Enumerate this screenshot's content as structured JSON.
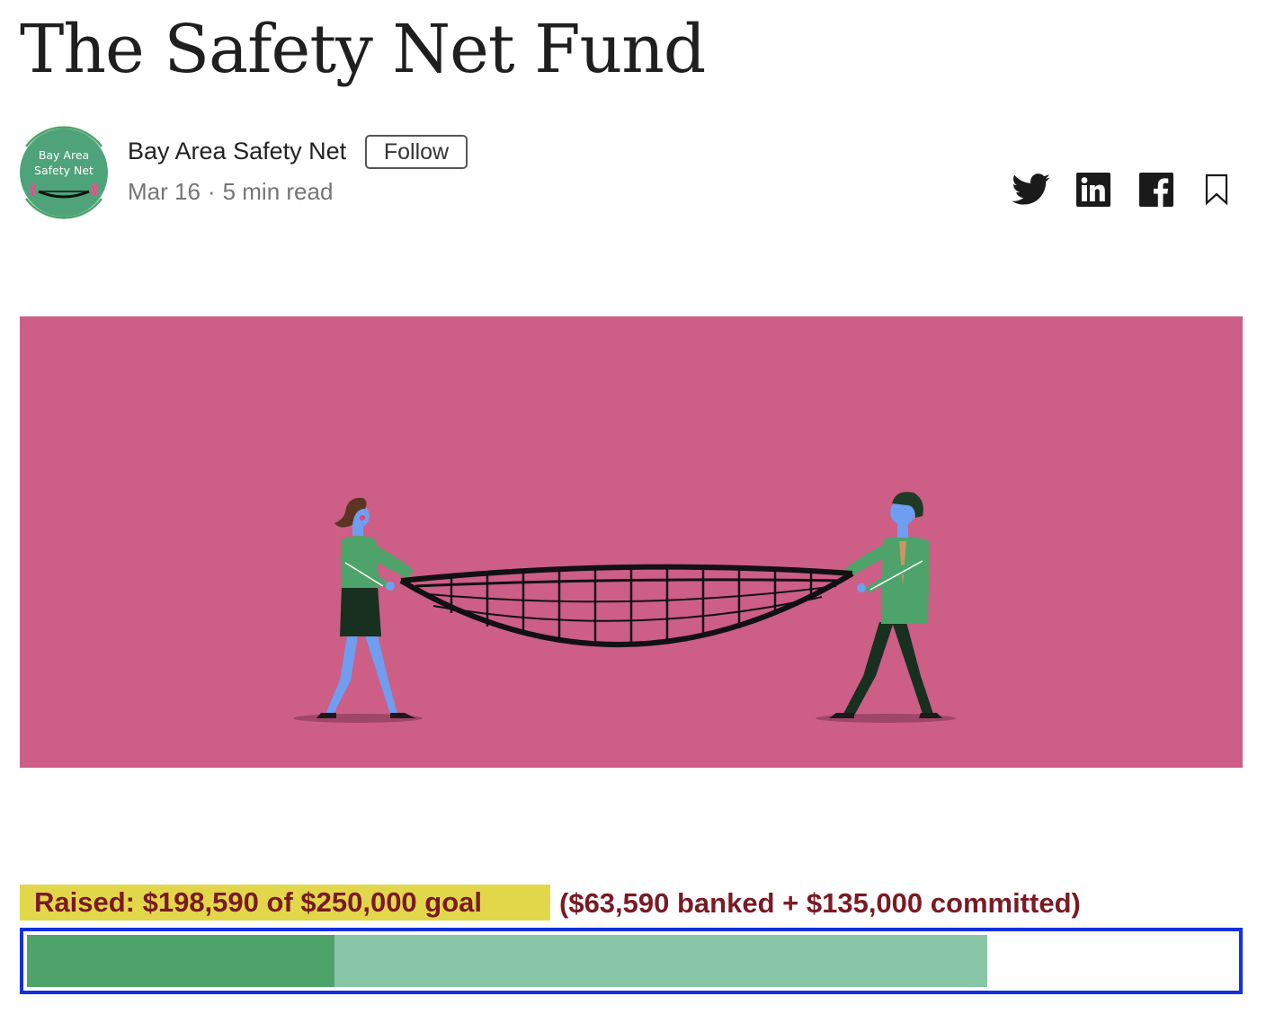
{
  "article": {
    "title": "The Safety Net Fund"
  },
  "author": {
    "avatar_text_line1": "Bay Area",
    "avatar_text_line2": "Safety Net",
    "name": "Bay Area Safety Net",
    "follow_label": "Follow",
    "date": "Mar 16",
    "separator": "·",
    "read_time": "5 min read"
  },
  "share": {
    "icons": [
      "twitter-icon",
      "linkedin-icon",
      "facebook-icon",
      "bookmark-icon"
    ],
    "color": "#1a1a1a"
  },
  "hero": {
    "background_color": "#cd5e86"
  },
  "fundraising": {
    "raised_text": "Raised: $198,590 of $250,000 goal",
    "breakdown_text": "($63,590 banked + $135,000 committed)",
    "goal": 250000,
    "banked": 63590,
    "committed": 135000,
    "raised": 198590,
    "colors": {
      "banked": "#4ea36a",
      "committed": "#88c6a7",
      "bar_border": "#1230e0",
      "label_highlight": "#e2d74a",
      "label_text": "#7a1a24"
    }
  }
}
